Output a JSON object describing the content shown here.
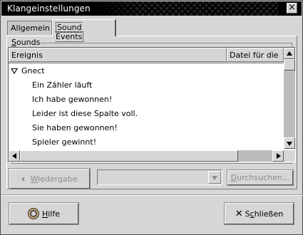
{
  "window": {
    "title": "Klangeinstellungen",
    "close_glyph": "×"
  },
  "tabs": [
    {
      "label": "Allgemein",
      "active": false
    },
    {
      "label": "Sound Events",
      "active": true
    }
  ],
  "sounds_frame": {
    "label_first": "S",
    "label_rest": "ounds"
  },
  "list": {
    "columns": [
      "Ereignis",
      "Datei für die"
    ],
    "group": {
      "label": "Gnect",
      "expanded": true
    },
    "rows": [
      "Ein Zähler läuft",
      "Ich habe gewonnen!",
      "Leider ist diese Spalte voll.",
      "Sie haben gewonnen!",
      "Spieler gewinnt!"
    ]
  },
  "controls": {
    "play_label_first": "W",
    "play_label_rest": "iedergabe",
    "play_icon": "speaker-icon",
    "file_combo_value": "",
    "browse_label_first": "D",
    "browse_label_rest": "urchsuchen..."
  },
  "footer": {
    "help_label_first": "H",
    "help_label_rest": "ilfe",
    "close_glyph": "✕",
    "close_label_before": "S",
    "close_label_underlined": "c",
    "close_label_rest": "hließen"
  },
  "colors": {
    "background": "#d6d6d6",
    "titlebar": "#000000",
    "list_background": "#ffffff",
    "disabled_text": "#8c8c8c"
  }
}
